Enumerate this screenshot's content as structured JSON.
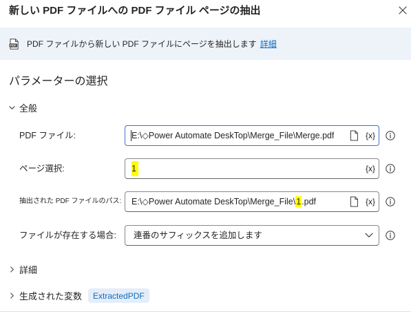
{
  "theme": {
    "accent": "#0f6cbd",
    "banner_background": "#eef3fa",
    "highlight": "#ffff00",
    "badge_background": "#e4edf9",
    "text": "#242424"
  },
  "dialog": {
    "title": "新しい PDF ファイルへの PDF ファイル ページの抽出",
    "close_icon": "close-icon"
  },
  "banner": {
    "icon": "pdf-file-icon",
    "icon_text": "PDF",
    "description": "PDF ファイルから新しい PDF ファイルにページを抽出します",
    "more_link": "詳細"
  },
  "parameters": {
    "heading": "パラメーターの選択",
    "general": {
      "label": "全般",
      "expanded": true,
      "variable_button": "{x}",
      "pdf_file": {
        "label": "PDF ファイル:",
        "value": "E:\\◇Power Automate DeskTop\\Merge_File\\Merge.pdf",
        "focused": true
      },
      "page_selection": {
        "label": "ページ選択:",
        "value": "1"
      },
      "extracted_pdf_path": {
        "label": "抽出された PDF ファイルのパス:",
        "value_before": "E:\\◇Power Automate DeskTop\\Merge_File\\",
        "value_highlighted": "1",
        "value_after": ".pdf"
      },
      "if_file_exists": {
        "label": "ファイルが存在する場合:",
        "selected": "連番のサフィックスを追加します"
      }
    },
    "advanced": {
      "label": "詳細",
      "expanded": false
    },
    "generated_variables": {
      "label": "生成された変数",
      "expanded": false,
      "variables": [
        "ExtractedPDF"
      ]
    }
  }
}
